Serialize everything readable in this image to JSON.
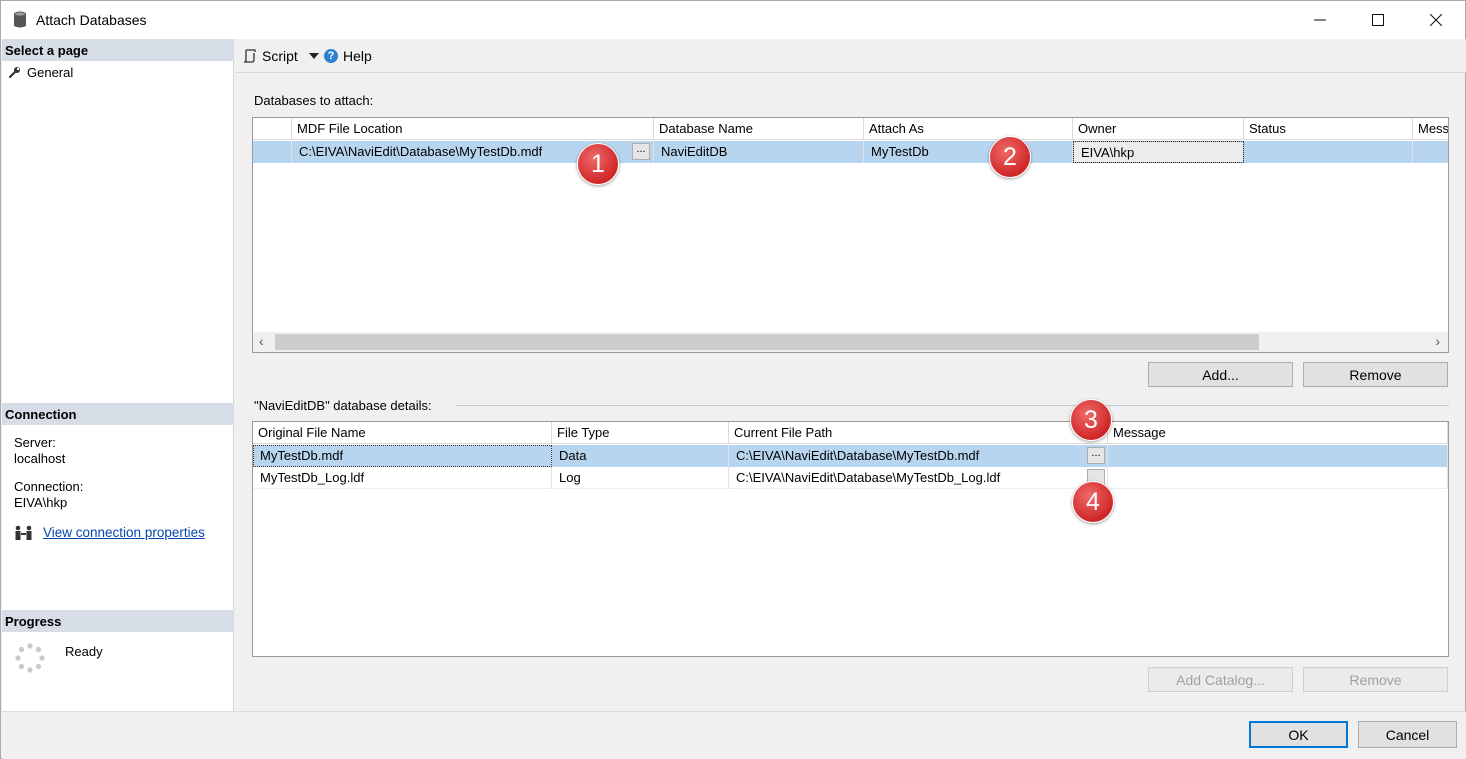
{
  "window": {
    "title": "Attach Databases"
  },
  "left": {
    "select_page": "Select a page",
    "page_general": "General",
    "connection_hdr": "Connection",
    "server_label": "Server:",
    "server_value": "localhost",
    "connection_label": "Connection:",
    "connection_value": "EIVA\\hkp",
    "view_props": "View connection properties",
    "progress_hdr": "Progress",
    "progress_status": "Ready"
  },
  "toolbar": {
    "script": "Script",
    "help": "Help"
  },
  "attach": {
    "label": "Databases to attach:",
    "columns": [
      "",
      "MDF File Location",
      "Database Name",
      "Attach As",
      "Owner",
      "Status",
      "Mess"
    ],
    "row": {
      "mdf": "C:\\EIVA\\NaviEdit\\Database\\MyTestDb.mdf",
      "dbname": "NaviEditDB",
      "attach_as": "MyTestDb",
      "owner": "EIVA\\hkp",
      "status": "",
      "message": ""
    },
    "add_button": "Add...",
    "remove_button": "Remove"
  },
  "details": {
    "label": "\"NaviEditDB\" database details:",
    "columns": [
      "Original File Name",
      "File Type",
      "Current File Path",
      "Message"
    ],
    "rows": [
      {
        "name": "MyTestDb.mdf",
        "type": "Data",
        "path": "C:\\EIVA\\NaviEdit\\Database\\MyTestDb.mdf",
        "message": ""
      },
      {
        "name": "MyTestDb_Log.ldf",
        "type": "Log",
        "path": "C:\\EIVA\\NaviEdit\\Database\\MyTestDb_Log.ldf",
        "message": ""
      }
    ],
    "add_catalog_button": "Add Catalog...",
    "remove_button": "Remove"
  },
  "footer": {
    "ok": "OK",
    "cancel": "Cancel"
  },
  "markers": [
    "1",
    "2",
    "3",
    "4"
  ],
  "ellipsis": "...",
  "colors": {
    "selected_row": "#b8d5f0",
    "link": "#0645ad",
    "marker": "#cf2727",
    "section_header": "#d7dde6"
  }
}
